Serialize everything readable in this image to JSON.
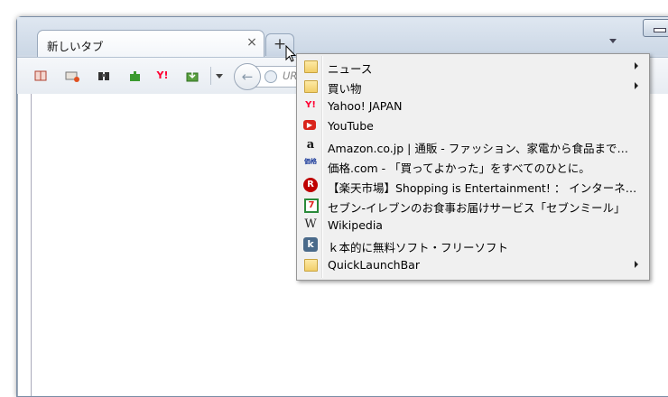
{
  "tab": {
    "title": "新しいタブ",
    "close": "×",
    "new_tab": "+"
  },
  "toolbar": {
    "icons": [
      "bookmark-icon",
      "reader-icon",
      "binoculars-icon",
      "addon-icon",
      "yahoo-icon",
      "download-icon"
    ],
    "yahoo_text": "Y!",
    "back": "←",
    "url_placeholder": "UR"
  },
  "menu": {
    "items": [
      {
        "label": "ニュース",
        "icon": "folder-icon",
        "submenu": true
      },
      {
        "label": "買い物",
        "icon": "folder-icon",
        "submenu": true
      },
      {
        "label": "Yahoo! JAPAN",
        "icon": "yahoo-icon",
        "icon_text": "Y!",
        "submenu": false
      },
      {
        "label": "YouTube",
        "icon": "youtube-icon",
        "icon_text": "▶",
        "submenu": false
      },
      {
        "label": "Amazon.co.jp | 通販 - ファッション、家電から食品まで…",
        "icon": "amazon-icon",
        "icon_text": "a",
        "submenu": false
      },
      {
        "label": "価格.com - 「買ってよかった」をすべてのひとに。",
        "icon": "kakaku-icon",
        "icon_text": "価格",
        "submenu": false
      },
      {
        "label": "【楽天市場】Shopping is Entertainment! ： インターネ…",
        "icon": "rakuten-icon",
        "icon_text": "R",
        "submenu": false
      },
      {
        "label": "セブン-イレブンのお食事お届けサービス「セブンミール」",
        "icon": "seven-eleven-icon",
        "icon_text": "7",
        "submenu": false
      },
      {
        "label": "Wikipedia",
        "icon": "wikipedia-icon",
        "icon_text": "W",
        "submenu": false
      },
      {
        "label": "ｋ本的に無料ソフト・フリーソフト",
        "icon": "k-icon",
        "icon_text": "k",
        "submenu": false
      },
      {
        "label": "QuickLaunchBar",
        "icon": "folder-icon",
        "submenu": true
      }
    ]
  },
  "colors": {
    "accent": "#cfd9e6",
    "youtube": "#d9241b",
    "yahoo": "#ff0033",
    "rakuten": "#bf0000"
  }
}
